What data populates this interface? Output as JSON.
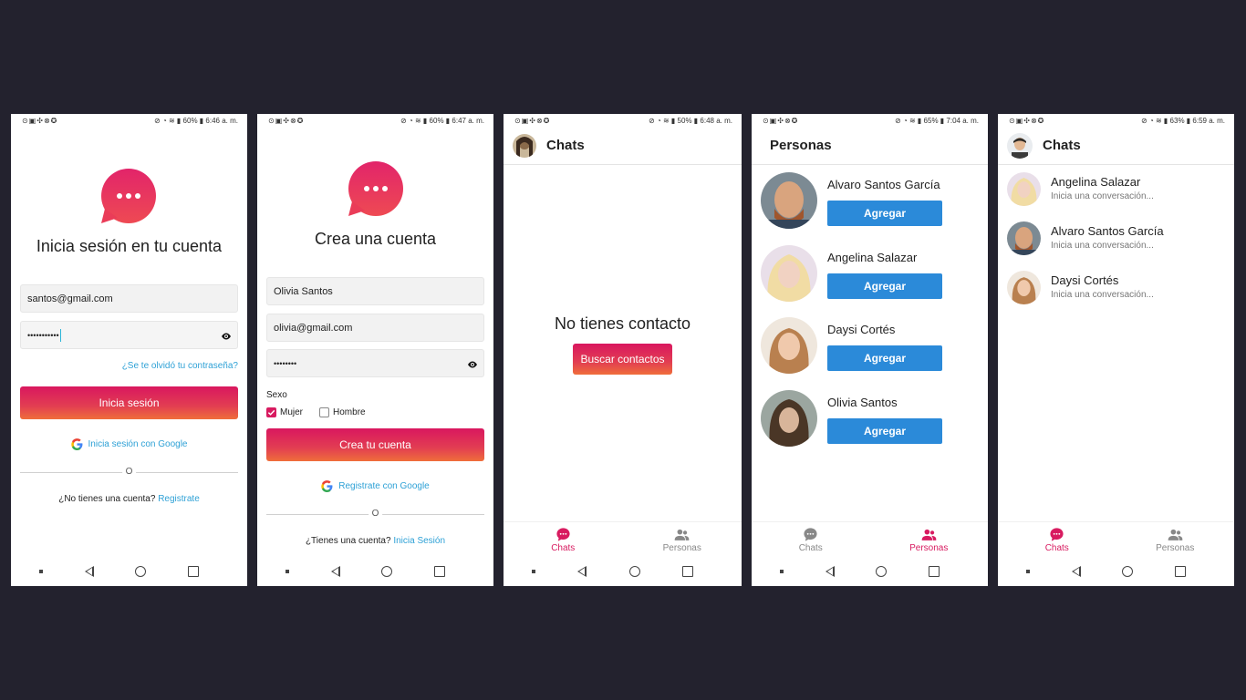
{
  "status": {
    "s1": {
      "battery": "60%",
      "time": "6:46 a. m."
    },
    "s2": {
      "battery": "60%",
      "time": "6:47 a. m."
    },
    "s3": {
      "battery": "50%",
      "time": "6:48 a. m."
    },
    "s4": {
      "battery": "65%",
      "time": "7:04 a. m."
    },
    "s5": {
      "battery": "63%",
      "time": "6:59 a. m."
    }
  },
  "colors": {
    "brand": "#d81b60",
    "accent_blue": "#2b8ad9",
    "link": "#2ea1d6"
  },
  "login": {
    "title": "Inicia sesión en tu cuenta",
    "email_value": "santos@gmail.com",
    "password_value": "•••••••••••",
    "forgot_link": "¿Se te olvidó tu contraseña?",
    "login_button": "Inicia sesión",
    "google_button": "Inicia sesión con Google",
    "divider": "O",
    "no_account": "¿No tienes una cuenta?",
    "register_link": "Registrate"
  },
  "register": {
    "title": "Crea una cuenta",
    "name_value": "Olivia Santos",
    "email_value": "olivia@gmail.com",
    "password_value": "••••••••",
    "sex_label": "Sexo",
    "option_female": "Mujer",
    "option_male": "Hombre",
    "female_checked": true,
    "male_checked": false,
    "create_button": "Crea tu cuenta",
    "google_button": "Registrate con Google",
    "divider": "O",
    "has_account": "¿Tienes una cuenta?",
    "login_link": "Inicia Sesión"
  },
  "chats_empty": {
    "header_title": "Chats",
    "empty_text": "No tienes contacto",
    "search_button": "Buscar contactos"
  },
  "tabs": {
    "chats": "Chats",
    "people": "Personas"
  },
  "people": {
    "header_title": "Personas",
    "add_label": "Agregar",
    "list": [
      {
        "name": "Alvaro Santos García"
      },
      {
        "name": "Angelina Salazar"
      },
      {
        "name": "Daysi Cortés"
      },
      {
        "name": "Olivia Santos"
      }
    ]
  },
  "chats": {
    "header_title": "Chats",
    "subtitle": "Inicia una conversación...",
    "list": [
      {
        "name": "Angelina Salazar"
      },
      {
        "name": "Alvaro Santos García"
      },
      {
        "name": "Daysi Cortés"
      }
    ]
  },
  "icons": [
    "chat-bubble-logo-icon",
    "eye-icon",
    "google-icon",
    "check-icon",
    "chat-tab-icon",
    "people-tab-icon"
  ]
}
